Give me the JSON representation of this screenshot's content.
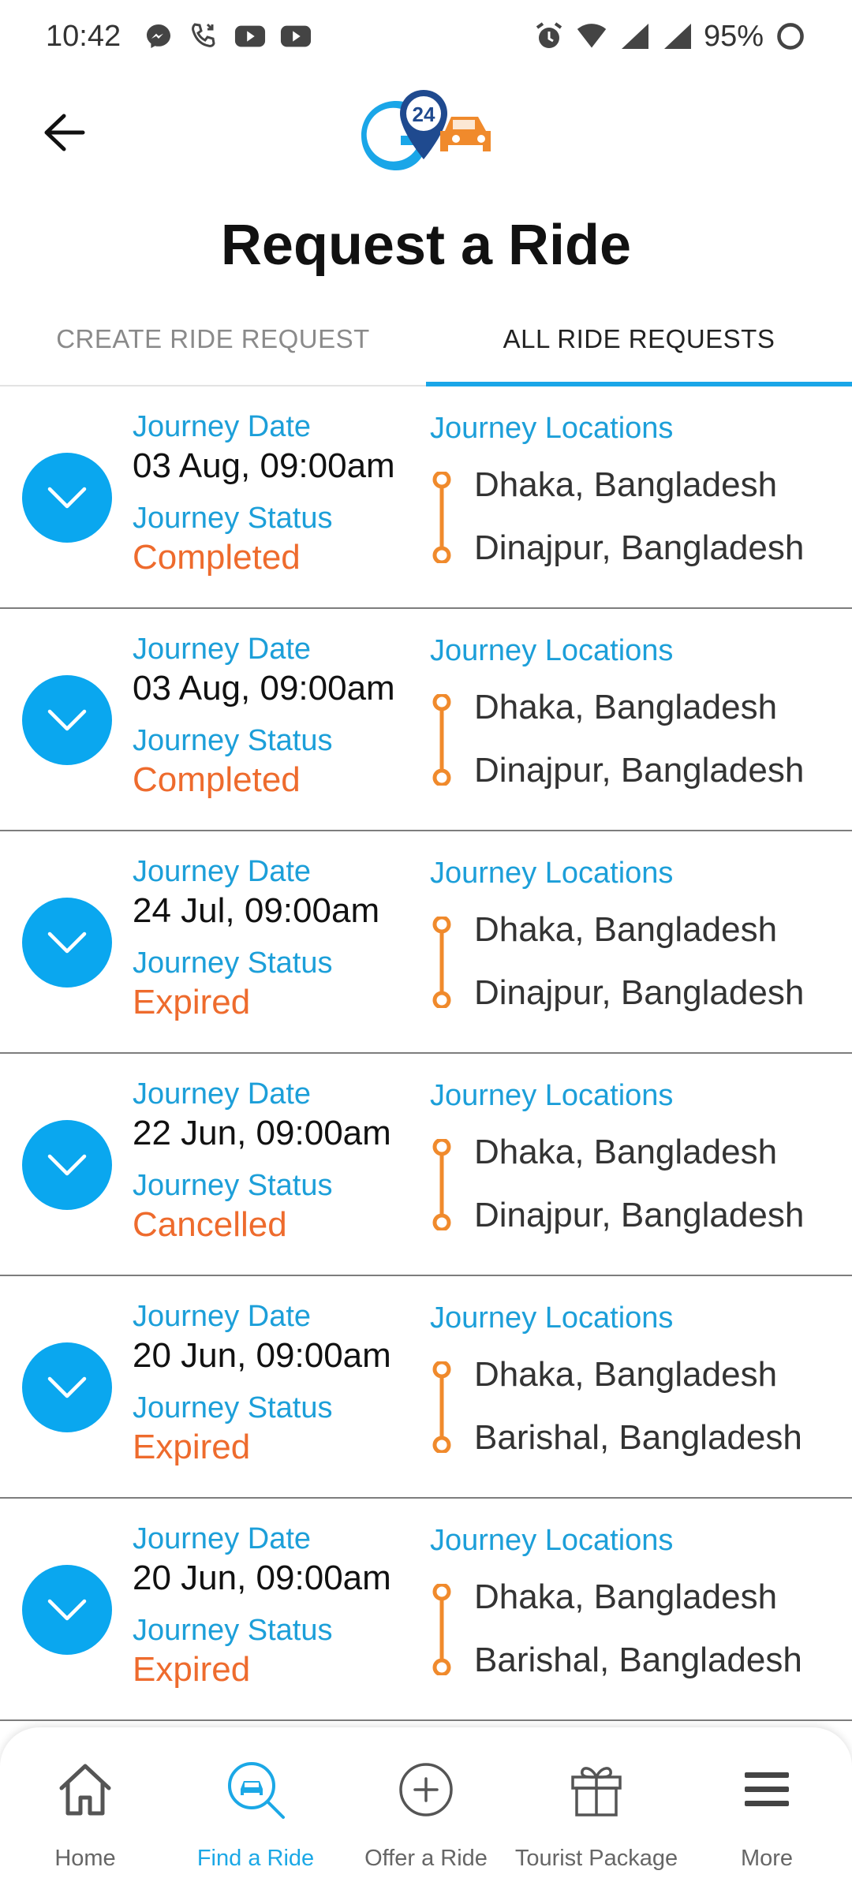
{
  "status_bar": {
    "time": "10:42",
    "battery": "95%",
    "left_icons": [
      "messenger-icon",
      "phone-call-icon",
      "youtube-icon",
      "youtube-icon"
    ],
    "right_icons": [
      "alarm-icon",
      "wifi-icon",
      "signal-icon",
      "signal-icon",
      "battery-icon"
    ]
  },
  "header": {
    "back_icon": "arrow-left-icon",
    "logo_text": "24",
    "title": "Request a Ride"
  },
  "tabs": [
    {
      "label": "CREATE RIDE REQUEST",
      "active": false
    },
    {
      "label": "ALL RIDE REQUESTS",
      "active": true
    }
  ],
  "labels": {
    "journey_date": "Journey Date",
    "journey_status": "Journey Status",
    "journey_locations": "Journey Locations"
  },
  "rides": [
    {
      "date": "03 Aug, 09:00am",
      "status": "Completed",
      "from": "Dhaka, Bangladesh",
      "to": "Dinajpur, Bangladesh"
    },
    {
      "date": "03 Aug, 09:00am",
      "status": "Completed",
      "from": "Dhaka, Bangladesh",
      "to": "Dinajpur, Bangladesh"
    },
    {
      "date": "24 Jul, 09:00am",
      "status": "Expired",
      "from": "Dhaka, Bangladesh",
      "to": "Dinajpur, Bangladesh"
    },
    {
      "date": "22 Jun, 09:00am",
      "status": "Cancelled",
      "from": "Dhaka, Bangladesh",
      "to": "Dinajpur, Bangladesh"
    },
    {
      "date": "20 Jun, 09:00am",
      "status": "Expired",
      "from": "Dhaka, Bangladesh",
      "to": "Barishal, Bangladesh"
    },
    {
      "date": "20 Jun, 09:00am",
      "status": "Expired",
      "from": "Dhaka, Bangladesh",
      "to": "Barishal, Bangladesh"
    }
  ],
  "bottom_nav": [
    {
      "label": "Home",
      "icon": "home-icon",
      "active": false
    },
    {
      "label": "Find a Ride",
      "icon": "find-ride-icon",
      "active": true
    },
    {
      "label": "Offer a Ride",
      "icon": "plus-circle-icon",
      "active": false
    },
    {
      "label": "Tourist Package",
      "icon": "gift-icon",
      "active": false
    },
    {
      "label": "More",
      "icon": "menu-icon",
      "active": false
    }
  ],
  "colors": {
    "accent_blue": "#0aa7ef",
    "label_blue": "#1c9fd9",
    "status_orange": "#ee6b2d",
    "route_orange": "#f08a2c"
  }
}
